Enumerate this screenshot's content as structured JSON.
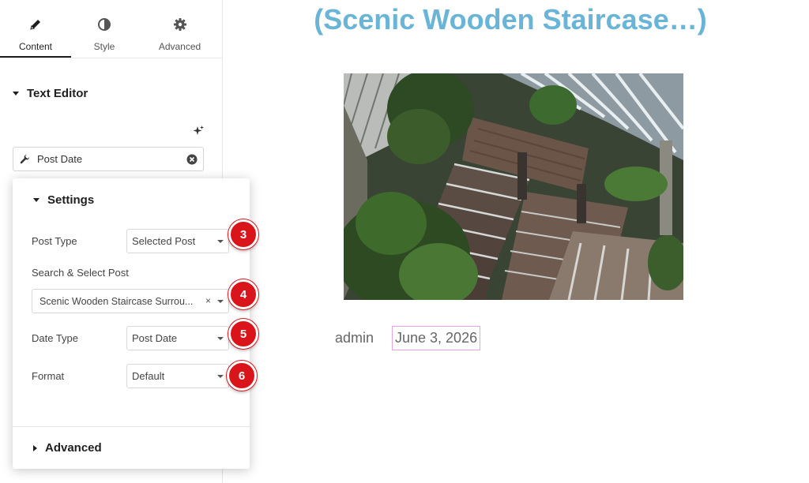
{
  "editor": {
    "tabs": [
      {
        "label": "Content",
        "icon": "pencil-icon",
        "active": true
      },
      {
        "label": "Style",
        "icon": "contrast-icon",
        "active": false
      },
      {
        "label": "Advanced",
        "icon": "gear-icon",
        "active": false
      }
    ],
    "section_title": "Text Editor",
    "dynamic_tag": {
      "label": "Post Date",
      "icon": "wrench-icon"
    }
  },
  "settings": {
    "title": "Settings",
    "fields": [
      {
        "label": "Post Type",
        "value": "Selected Post",
        "badge": "3"
      },
      {
        "label": "Search & Select Post",
        "value": "Scenic Wooden Staircase Surrou...",
        "badge": "4"
      },
      {
        "label": "Date Type",
        "value": "Post Date",
        "badge": "5"
      },
      {
        "label": "Format",
        "value": "Default",
        "badge": "6"
      }
    ],
    "advanced_label": "Advanced",
    "clear_symbol": "×"
  },
  "preview": {
    "title": "(Scenic Wooden Staircase…)",
    "image_alt": "Aerial view of a wooden staircase surrounded by plants",
    "author": "admin",
    "date": "June 3, 2026"
  },
  "colors": {
    "title": "#6ab4d8",
    "badge": "#d9141b",
    "date_highlight": "#e2a6e2"
  }
}
